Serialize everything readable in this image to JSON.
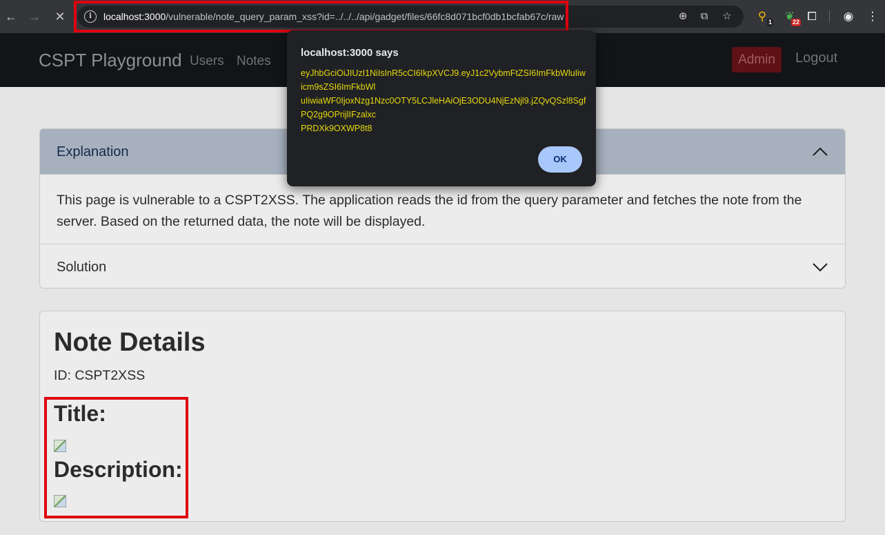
{
  "browser": {
    "url_host": "localhost:3000",
    "url_path": "/vulnerable/note_query_param_xss?id=../../../api/gadget/files/66fc8d071bcf0db1bcfab67c/raw",
    "extension_badge_1": "1",
    "extension_badge_2": "22"
  },
  "navbar": {
    "brand": "CSPT Playground",
    "links": [
      "Users",
      "Notes"
    ],
    "admin": "Admin",
    "logout": "Logout"
  },
  "accordion": {
    "explanation_title": "Explanation",
    "explanation_body": "This page is vulnerable to a CSPT2XSS. The application reads the id from the query parameter and fetches the note from the server. Based on the returned data, the note will be displayed.",
    "solution_title": "Solution"
  },
  "note": {
    "heading": "Note Details",
    "id_line": "ID: CSPT2XSS",
    "title_label": "Title:",
    "description_label": "Description:"
  },
  "dialog": {
    "title": "localhost:3000 says",
    "message_lines": [
      "eyJhbGciOiJIUzI1NiIsInR5cCI6IkpXVCJ9.eyJ1c2VybmFtZSI6ImFkbWluIiw",
      "icm9sZSI6ImFkbWl",
      "uIiwiaWF0IjoxNzg1Nzc0OTY5LCJleHAiOjE3ODU4NjEzNjl9.jZQvQSzl8Sgf",
      "PQ2g9OPrijlIFzalxc",
      "PRDXk9OXWP8t8"
    ],
    "ok": "OK"
  },
  "colors": {
    "highlight_box": "#e0000f",
    "dialog_text": "#e6d90d",
    "ok_button": "#a8c7fa"
  }
}
